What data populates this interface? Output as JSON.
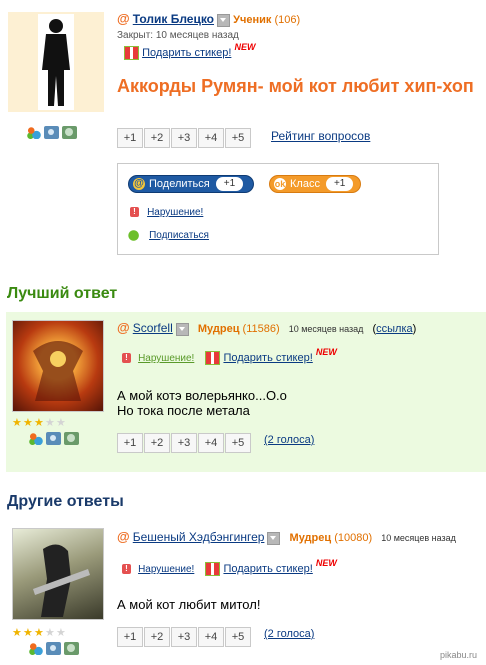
{
  "question": {
    "author": "Толик Блецко",
    "rank": "Ученик",
    "rank_points": "(106)",
    "status": "Закрыт: 10 месяцев назад",
    "gift_label": "Подарить стикер!",
    "new_badge": "NEW",
    "title": "Аккорды Румян- мой кот любит хип-хоп",
    "votes": [
      "+1",
      "+2",
      "+3",
      "+4",
      "+5"
    ],
    "rating_link": "Рейтинг вопросов",
    "share_label": "Поделиться",
    "share_count": "+1",
    "class_label": "Класс",
    "class_count": "+1",
    "violation_label": "Нарушение!",
    "subscribe_label": "Подписаться"
  },
  "best_answer": {
    "heading": "Лучший ответ",
    "author": "Scorfell",
    "rank": "Мудрец",
    "rank_points": "(11586)",
    "time": "10 месяцев назад",
    "link_label": "ссылка",
    "violation_label": "Нарушение!",
    "gift_label": "Подарить стикер!",
    "new_badge": "NEW",
    "text_lines": [
      "А мой котэ волерьянко...О.о",
      "Но тока после метала"
    ],
    "votes": [
      "+1",
      "+2",
      "+3",
      "+4",
      "+5"
    ],
    "votes_count": "(2 голоса)",
    "stars_filled": 3,
    "stars_total": 5
  },
  "other_answers": {
    "heading": "Другие ответы",
    "items": [
      {
        "author": "Бешеный Хэдбэнгингер",
        "rank": "Мудрец",
        "rank_points": "(10080)",
        "time": "10 месяцев назад",
        "violation_label": "Нарушение!",
        "gift_label": "Подарить стикер!",
        "new_badge": "NEW",
        "text": "А мой кот любит митол!",
        "votes": [
          "+1",
          "+2",
          "+3",
          "+4",
          "+5"
        ],
        "votes_count": "(2 голоса)",
        "stars_filled": 3,
        "stars_total": 5
      }
    ]
  },
  "watermark": "pikabu.ru",
  "colors": {
    "accent_orange": "#ee6e24",
    "link_blue": "#0a3a82",
    "best_bg": "#ecfae0",
    "heading_green": "#3a8a10"
  }
}
